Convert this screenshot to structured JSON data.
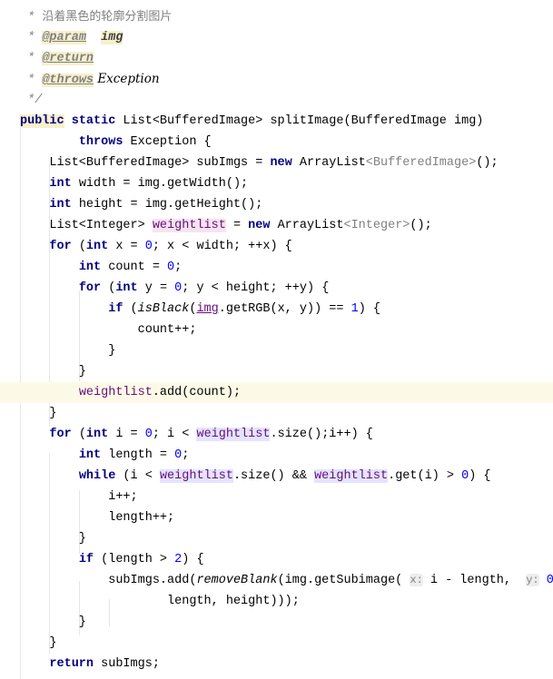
{
  "editor": {
    "language": "Java",
    "current_line_index": 19,
    "colors": {
      "keyword": "#000080",
      "number": "#0000ff",
      "comment": "#808080",
      "field": "#660e7a",
      "current_line": "#fcfae6",
      "usage_highlight": "#e4e4ff"
    },
    "lines": [
      [
        [
          "c",
          " /**"
        ]
      ],
      [
        [
          "c",
          " * "
        ],
        [
          "zh",
          "沿着黑色的轮廓分割图片"
        ]
      ],
      [
        [
          "c",
          " * "
        ],
        [
          "t",
          "@param"
        ],
        [
          "",
          "  "
        ],
        [
          "p",
          "img"
        ]
      ],
      [
        [
          "c",
          " * "
        ],
        [
          "t",
          "@return"
        ]
      ],
      [
        [
          "c",
          " * "
        ],
        [
          "t",
          "@throws"
        ],
        [
          "cj",
          " Exception"
        ]
      ],
      [
        [
          "c",
          " */"
        ]
      ],
      [
        [
          "kb",
          "public"
        ],
        [
          "",
          " "
        ],
        [
          "k",
          "static"
        ],
        [
          "",
          " List<BufferedImage> splitImage(BufferedImage img)"
        ]
      ],
      [
        [
          "",
          "        "
        ],
        [
          "k",
          "throws"
        ],
        [
          "",
          " Exception {"
        ]
      ],
      [
        [
          "",
          "    List<BufferedImage> subImgs = "
        ],
        [
          "k",
          "new"
        ],
        [
          "",
          " ArrayList"
        ],
        [
          "g",
          "<BufferedImage>"
        ],
        [
          "",
          "();"
        ]
      ],
      [
        [
          "",
          "    "
        ],
        [
          "k",
          "int"
        ],
        [
          "",
          " width = img.getWidth();"
        ]
      ],
      [
        [
          "",
          "    "
        ],
        [
          "k",
          "int"
        ],
        [
          "",
          " height = img.getHeight();"
        ]
      ],
      [
        [
          "",
          "    List<Integer> "
        ],
        [
          "fd",
          "weightlist"
        ],
        [
          "",
          " = "
        ],
        [
          "k",
          "new"
        ],
        [
          "",
          " ArrayList"
        ],
        [
          "g",
          "<Integer>"
        ],
        [
          "",
          "();"
        ]
      ],
      [
        [
          "",
          "    "
        ],
        [
          "k",
          "for"
        ],
        [
          "",
          " ("
        ],
        [
          "k",
          "int"
        ],
        [
          "",
          " x = "
        ],
        [
          "n",
          "0"
        ],
        [
          "",
          "; x < width; ++x) {"
        ]
      ],
      [
        [
          "",
          "        "
        ],
        [
          "k",
          "int"
        ],
        [
          "",
          " count = "
        ],
        [
          "n",
          "0"
        ],
        [
          "",
          ";"
        ]
      ],
      [
        [
          "",
          "        "
        ],
        [
          "k",
          "for"
        ],
        [
          "",
          " ("
        ],
        [
          "k",
          "int"
        ],
        [
          "",
          " y = "
        ],
        [
          "n",
          "0"
        ],
        [
          "",
          "; y < height; ++y) {"
        ]
      ],
      [
        [
          "",
          "            "
        ],
        [
          "k",
          "if"
        ],
        [
          "",
          " ("
        ],
        [
          "s",
          "isBlack"
        ],
        [
          "",
          "("
        ],
        [
          "u",
          "img"
        ],
        [
          "",
          ".getRGB(x, y)) == "
        ],
        [
          "n",
          "1"
        ],
        [
          "",
          ") {"
        ]
      ],
      [
        [
          "",
          "                count++;"
        ]
      ],
      [
        [
          "",
          "            }"
        ]
      ],
      [
        [
          "",
          "        }"
        ]
      ],
      [
        [
          "",
          "        "
        ],
        [
          "f",
          "weightlist"
        ],
        [
          "",
          ".add(count);"
        ]
      ],
      [
        [
          "",
          "    }"
        ]
      ],
      [
        [
          "",
          "    "
        ],
        [
          "k",
          "for"
        ],
        [
          "",
          " ("
        ],
        [
          "k",
          "int"
        ],
        [
          "",
          " i = "
        ],
        [
          "n",
          "0"
        ],
        [
          "",
          "; i < "
        ],
        [
          "fu",
          "weightlist"
        ],
        [
          "",
          ".size();i++) {"
        ]
      ],
      [
        [
          "",
          "        "
        ],
        [
          "k",
          "int"
        ],
        [
          "",
          " length = "
        ],
        [
          "n",
          "0"
        ],
        [
          "",
          ";"
        ]
      ],
      [
        [
          "",
          "        "
        ],
        [
          "k",
          "while"
        ],
        [
          "",
          " (i < "
        ],
        [
          "fu",
          "weightlist"
        ],
        [
          "",
          ".size() && "
        ],
        [
          "fu",
          "weightlist"
        ],
        [
          "",
          ".get(i) > "
        ],
        [
          "n",
          "0"
        ],
        [
          "",
          ") {"
        ]
      ],
      [
        [
          "",
          "            i++;"
        ]
      ],
      [
        [
          "",
          "            length++;"
        ]
      ],
      [
        [
          "",
          "        }"
        ]
      ],
      [
        [
          "",
          "        "
        ],
        [
          "k",
          "if"
        ],
        [
          "",
          " (length > "
        ],
        [
          "n",
          "2"
        ],
        [
          "",
          ") {"
        ]
      ],
      [
        [
          "",
          "            subImgs.add("
        ],
        [
          "s",
          "removeBlank"
        ],
        [
          "",
          "(img.getSubimage( "
        ],
        [
          "h",
          "x:"
        ],
        [
          "",
          " i - length,  "
        ],
        [
          "h",
          "y:"
        ],
        [
          "",
          " "
        ],
        [
          "n",
          "0"
        ],
        [
          "",
          ","
        ]
      ],
      [
        [
          "",
          "                    length, height)));"
        ]
      ],
      [
        [
          "",
          "        }"
        ]
      ],
      [
        [
          "",
          "    }"
        ]
      ],
      [
        [
          "",
          "    "
        ],
        [
          "k",
          "return"
        ],
        [
          "",
          " subImgs;"
        ]
      ]
    ]
  }
}
